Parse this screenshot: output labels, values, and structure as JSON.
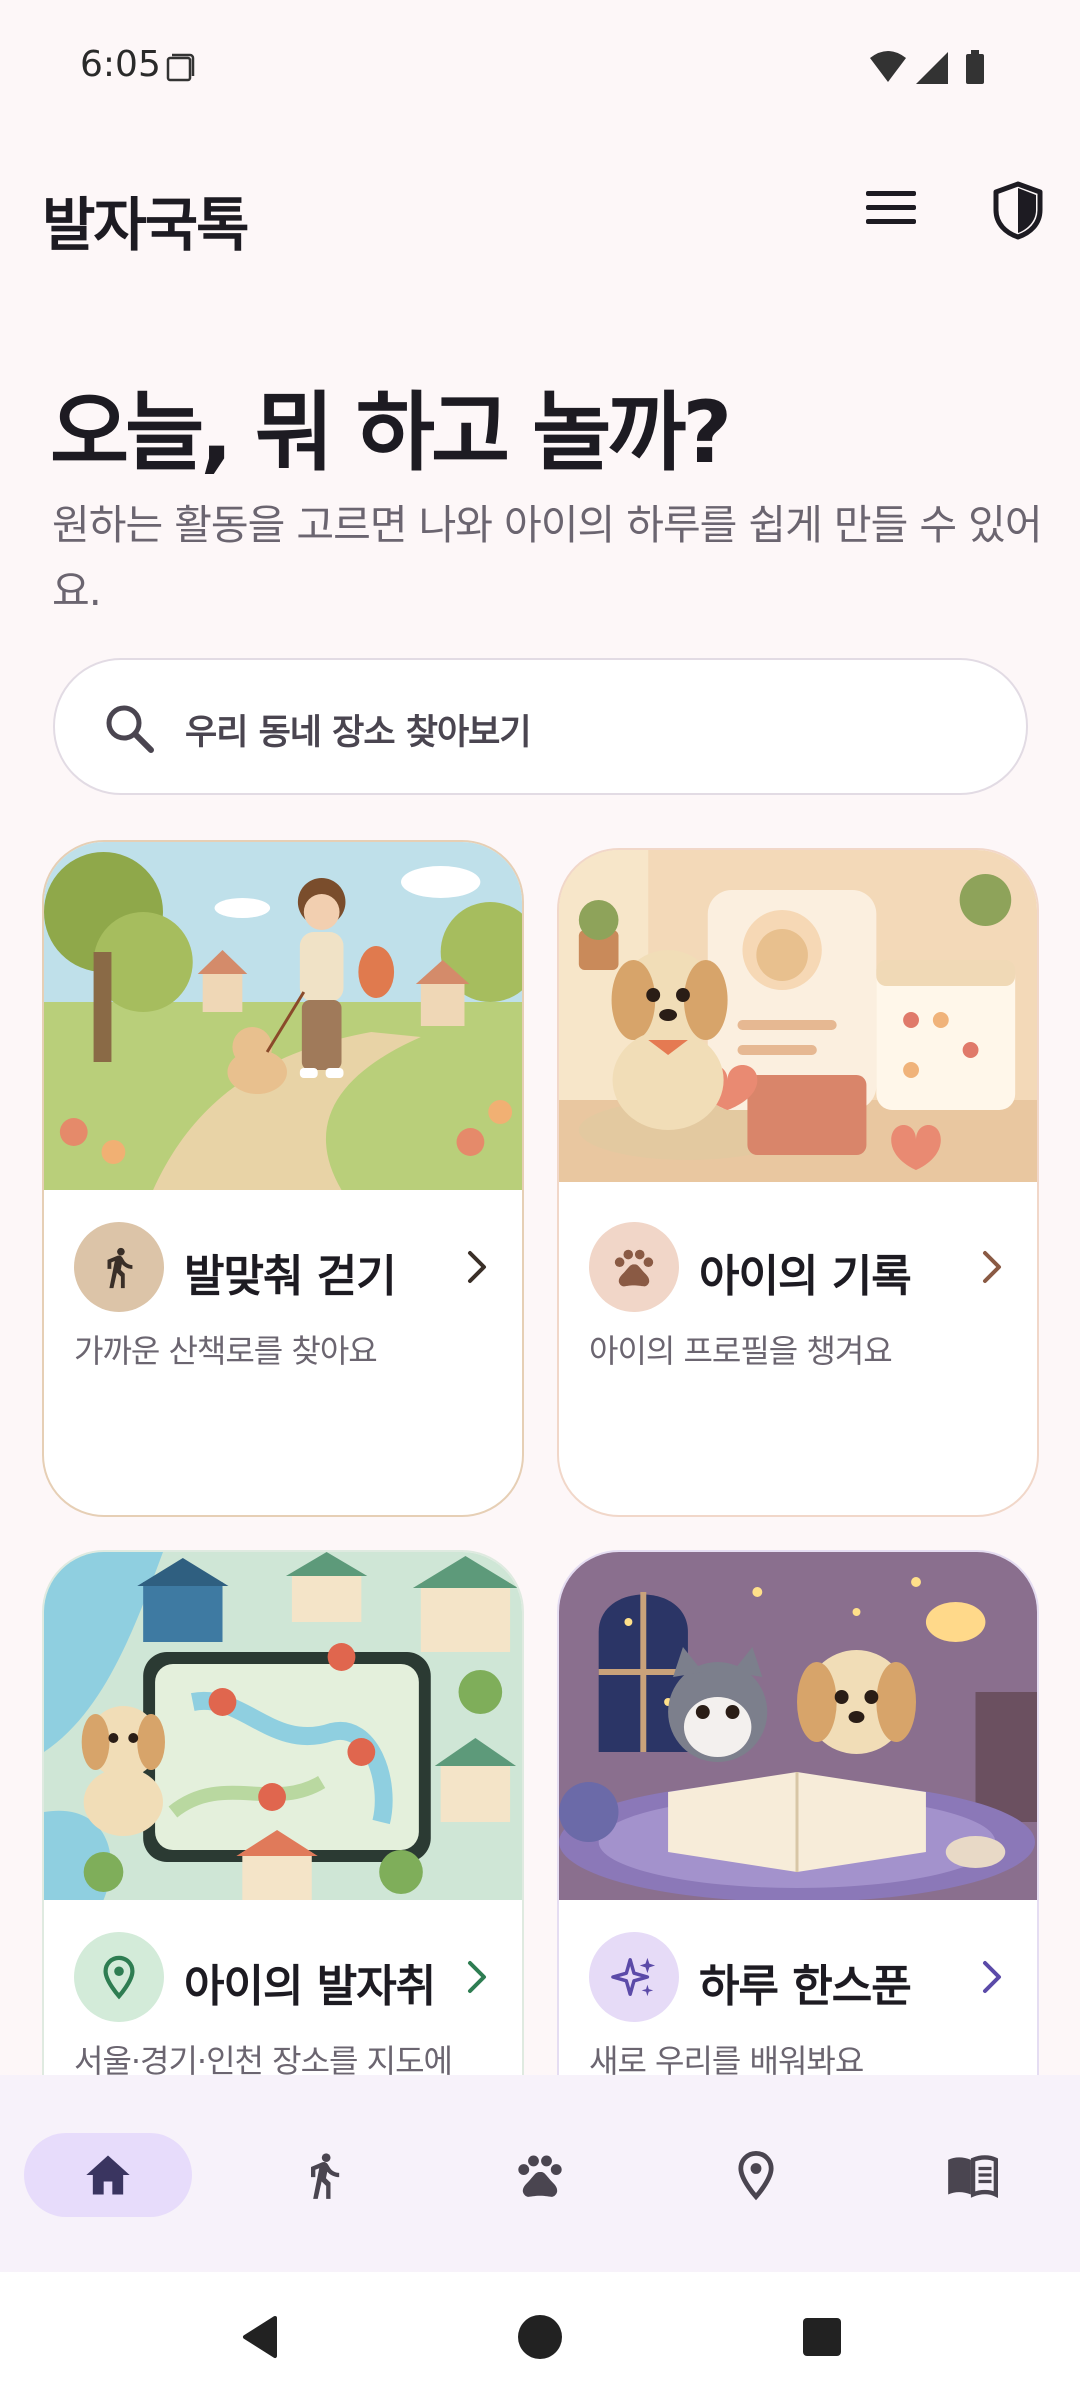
{
  "status": {
    "time": "6:05"
  },
  "app": {
    "title": "발자국톡"
  },
  "hero": {
    "title": "오늘, 뭐 하고 놀까?",
    "subtitle": "원하는 활동을 고르면 나와 아이의 하루를 쉽게 만들 수 있어요."
  },
  "search": {
    "placeholder": "우리 동네 장소 찾아보기"
  },
  "cards": [
    {
      "title": "발맞춰 걷기",
      "desc": "가까운 산책로를 찾아요",
      "icon": "walk-icon",
      "accent": "#3a2f28"
    },
    {
      "title": "아이의 기록",
      "desc": "아이의 프로필을 챙겨요",
      "icon": "paw-icon",
      "accent": "#8a5a44"
    },
    {
      "title": "아이의 발자취",
      "desc": "서울·경기·인천 장소를 지도에",
      "icon": "location-pin-icon",
      "accent": "#2e7d52"
    },
    {
      "title": "하루 한스푼",
      "desc": "새로 우리를 배워봐요",
      "icon": "sparkle-icon",
      "accent": "#5b4aa8"
    }
  ],
  "bottom_nav": [
    {
      "name": "home",
      "icon": "home-icon",
      "active": true
    },
    {
      "name": "walk",
      "icon": "walk-icon",
      "active": false
    },
    {
      "name": "paw",
      "icon": "paw-icon",
      "active": false
    },
    {
      "name": "map",
      "icon": "location-pin-icon",
      "active": false
    },
    {
      "name": "book",
      "icon": "book-icon",
      "active": false
    }
  ],
  "colors": {
    "background": "#fdf7f8",
    "nav_active": "#e7dcfb",
    "text_primary": "#1d1b22",
    "text_secondary": "#6b6570"
  }
}
